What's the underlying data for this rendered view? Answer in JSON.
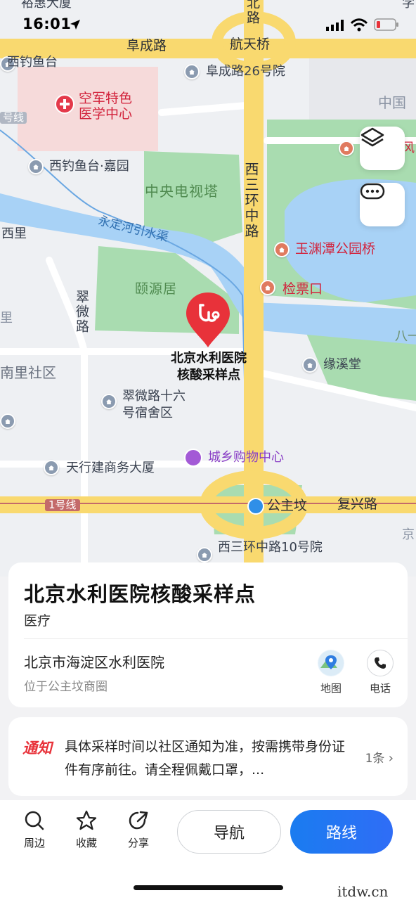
{
  "status_bar": {
    "time": "16:01"
  },
  "map": {
    "labels": {
      "top_cut": "裕惠大厦",
      "top_right_cut": "学",
      "fuchenglu": "阜成路",
      "beilu": "北路",
      "hangtianqiao": "航天桥",
      "xidiaoyutai": "西钓鱼台",
      "fuchenglu26": "阜成路26号院",
      "kongjun": "空军特色医学中心",
      "zhongguo": "中国",
      "line1_top": "号线",
      "xidiaoyutai_jiayuan": "西钓鱼台·嘉园",
      "xisanhuan_zhonglu": "西三环中路",
      "feng": "风",
      "cctv": "中央电视塔",
      "xili": "西里",
      "yongding": "永定河引水渠",
      "yuyuantan": "玉渊潭公园桥",
      "yiyuanju": "颐源居",
      "jianpiaokou": "检票口",
      "cuiweilu": "翠微路",
      "li_left": "里",
      "bayi": "八一",
      "pin_label": "北京水利医院核酸采样点",
      "yuanxitang": "缘溪堂",
      "nanlishequ": "南里社区",
      "cuiweilu16": "翠微路十六号宿舍区",
      "chengxiang": "城乡购物中心",
      "tianxing": "天行建商务大厦",
      "line1_bottom": "1号线",
      "gongzhufen": "公主坟",
      "fuxinglu": "复兴路",
      "jing": "京",
      "xisanhuan_bottom": "西三环中路10号院"
    }
  },
  "detail_card": {
    "title": "北京水利医院核酸采样点",
    "category": "医疗",
    "address": "北京市海淀区水利医院",
    "area": "位于公主坟商圈",
    "map_label": "地图",
    "phone_label": "电话"
  },
  "notice": {
    "tag": "通知",
    "text": "具体采样时间以社区通知为准，按需携带身份证件有序前往。请全程佩戴口罩，...",
    "count": "1条"
  },
  "toolbar": {
    "nearby": "周边",
    "favorite": "收藏",
    "share": "分享",
    "navigate": "导航",
    "route": "路线"
  },
  "watermark": "itdw.cn",
  "colors": {
    "route_blue": "#1f78f2",
    "pin_red": "#e8323a",
    "road_yellow": "#f7d36a",
    "water": "#a9d3f5",
    "park_green": "#a7dcae"
  }
}
